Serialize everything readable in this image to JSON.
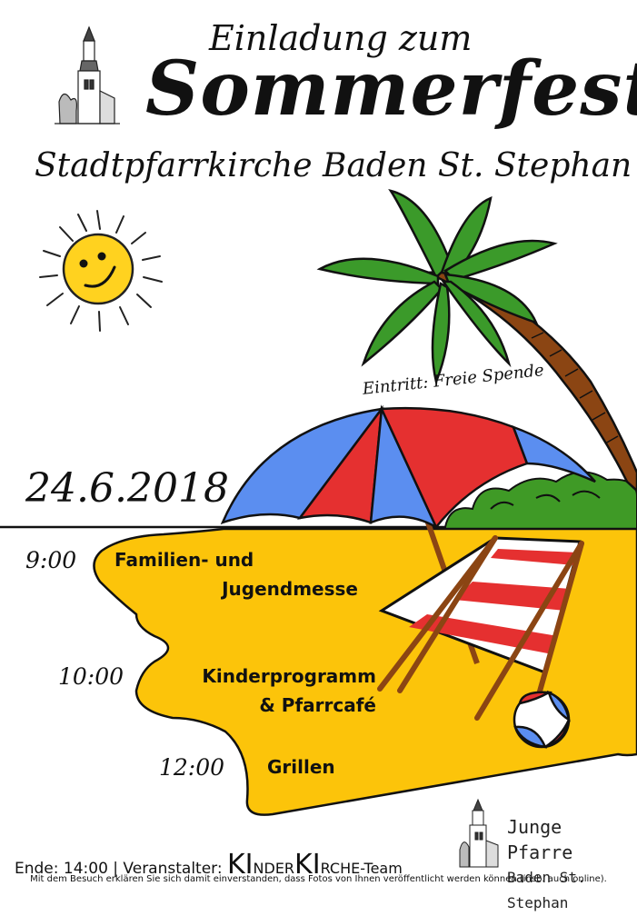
{
  "header": {
    "invite": "Einladung zum",
    "title": "Sommerfest",
    "venue": "Stadtpfarrkirche Baden St. Stephan"
  },
  "admission": "Eintritt: Freie Spende",
  "date": "24.6.2018",
  "schedule": [
    {
      "time": "9:00",
      "line1": "Familien- und",
      "line2": "Jugendmesse"
    },
    {
      "time": "10:00",
      "line1": "Kinderprogramm",
      "line2": "& Pfarrcafé"
    },
    {
      "time": "12:00",
      "line1": "Grillen",
      "line2": ""
    }
  ],
  "footer": {
    "end_and_organizer": "Ende: 14:00 | Veranstalter:",
    "team_ki1": "KI",
    "team_nder": "NDER",
    "team_ki2": "KI",
    "team_rche": "RCHE-Team",
    "disclaimer": "Mit dem Besuch erklären Sie sich damit einverstanden, dass Fotos von Ihnen veröffentlicht werden können (insb. auch online)."
  },
  "logo": {
    "line1": "Junge Pfarre",
    "line2": "Baden St. Stephan"
  },
  "colors": {
    "sand": "#fcc40a",
    "sun": "#ffd21f",
    "palm_leaf": "#3b9a2a",
    "trunk": "#8b4513",
    "umbrella_red": "#e53030",
    "umbrella_blue": "#5b8ef0",
    "bush": "#3f9a26"
  },
  "icons": [
    "church-icon",
    "sun-icon",
    "palm-tree-icon",
    "beach-umbrella-icon",
    "deck-chair-icon",
    "beach-ball-icon"
  ]
}
